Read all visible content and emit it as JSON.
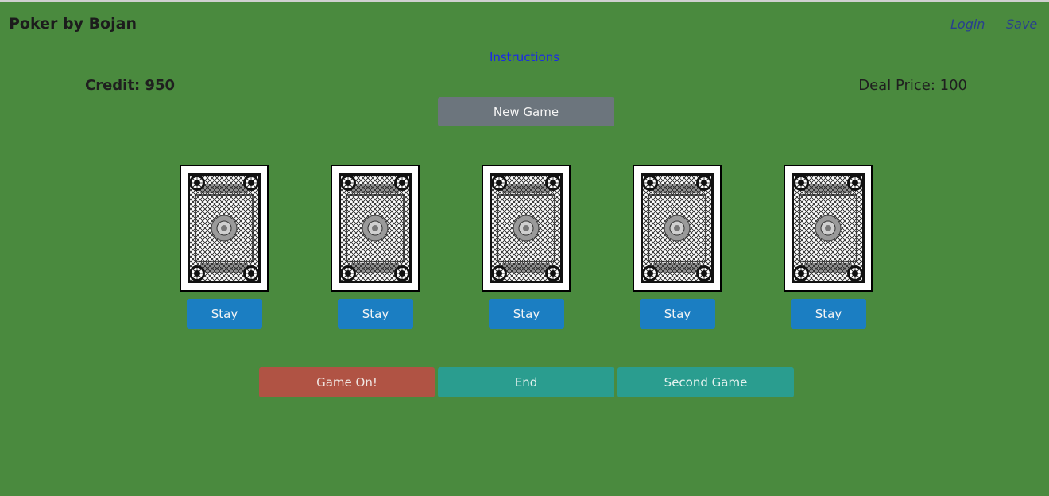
{
  "header": {
    "brand": "Poker by Bojan",
    "login_label": "Login",
    "save_label": "Save"
  },
  "instructions_label": "Instructions",
  "status": {
    "credit": "Credit: 950",
    "deal_price": "Deal Price: 100"
  },
  "new_game_label": "New Game",
  "cards": [
    {
      "face": "back",
      "stay_label": "Stay"
    },
    {
      "face": "back",
      "stay_label": "Stay"
    },
    {
      "face": "back",
      "stay_label": "Stay"
    },
    {
      "face": "back",
      "stay_label": "Stay"
    },
    {
      "face": "back",
      "stay_label": "Stay"
    }
  ],
  "actions": {
    "game_on_label": "Game On!",
    "end_label": "End",
    "second_game_label": "Second Game"
  },
  "colors": {
    "table": "#4a8a3e",
    "stay_button": "#1b7ec2",
    "new_game_button": "#6c757d",
    "game_on_button": "#b05344",
    "end_button": "#2a9d8f"
  }
}
